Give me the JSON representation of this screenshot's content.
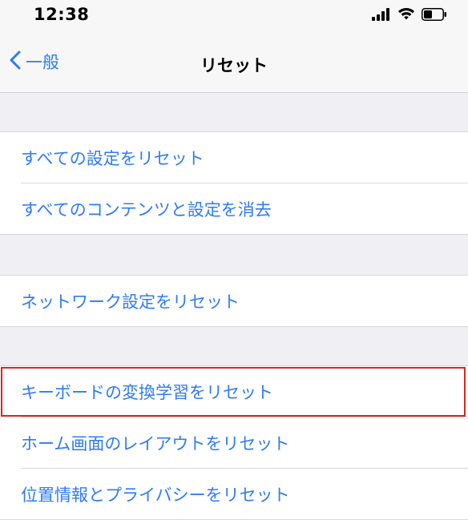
{
  "status_bar": {
    "time": "12:38",
    "icons": [
      "cellular-signal-icon",
      "wifi-icon",
      "battery-icon"
    ]
  },
  "nav": {
    "back_label": "一般",
    "back_icon": "chevron-left-icon",
    "title": "リセット"
  },
  "groups": [
    {
      "rows": [
        {
          "label": "すべての設定をリセット"
        },
        {
          "label": "すべてのコンテンツと設定を消去"
        }
      ]
    },
    {
      "rows": [
        {
          "label": "ネットワーク設定をリセット"
        }
      ]
    },
    {
      "rows": [
        {
          "label": "キーボードの変換学習をリセット"
        },
        {
          "label": "ホーム画面のレイアウトをリセット"
        },
        {
          "label": "位置情報とプライバシーをリセット"
        }
      ]
    }
  ],
  "colors": {
    "accent": "#2f7bf5",
    "highlight": "#d9261c",
    "background": "#efeff4"
  }
}
